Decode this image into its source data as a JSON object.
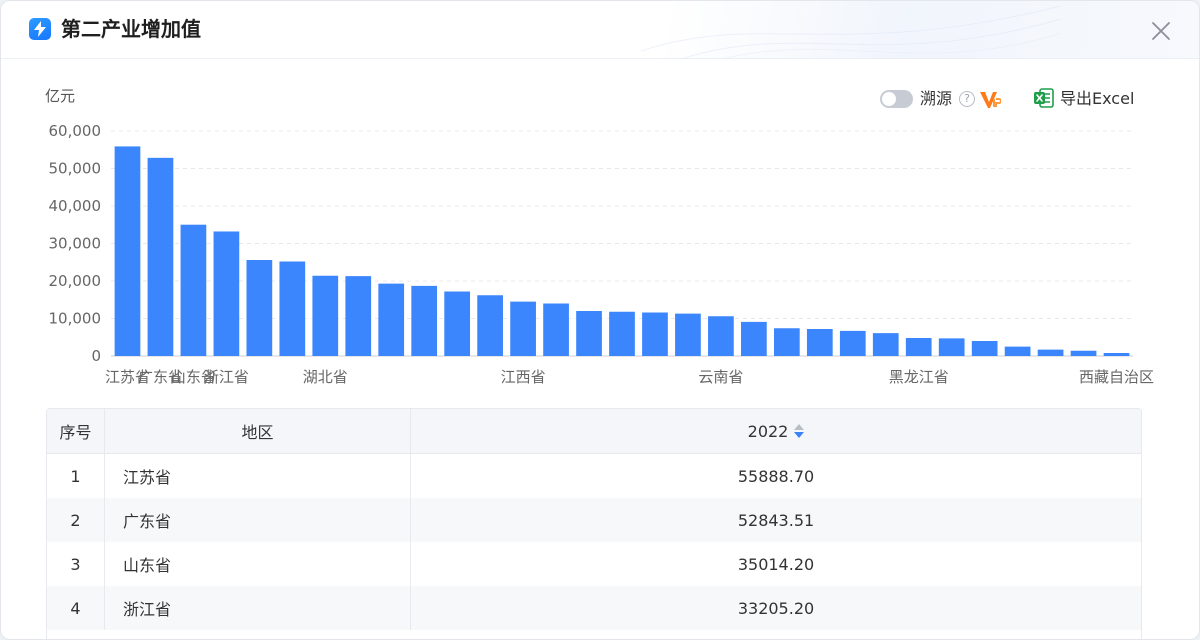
{
  "header": {
    "title": "第二产业增加值"
  },
  "toolbar": {
    "trace_label": "溯源",
    "help_glyph": "?",
    "export_label": "导出Excel"
  },
  "colors": {
    "bar": "#3b86fc",
    "accent": "#1677ff",
    "excel": "#1f9e4a",
    "vip": "#ff7a1a"
  },
  "icons": {
    "logo": "lightning-icon",
    "close": "close-icon",
    "help": "question-icon",
    "vip": "vip-icon",
    "export": "excel-icon"
  },
  "chart_data": {
    "type": "bar",
    "ylabel": "亿元",
    "ylim": [
      0,
      60000
    ],
    "yticks": [
      "0",
      "10,000",
      "20,000",
      "30,000",
      "40,000",
      "50,000",
      "60,000"
    ],
    "grid": true,
    "visible_tick_labels": [
      "江苏省",
      "湖北省",
      "江西省",
      "云南省",
      "黑龙江省",
      "西藏自治区"
    ],
    "categories": [
      "江苏省",
      "广东省",
      "山东省",
      "浙江省",
      "",
      "",
      "湖北省",
      "",
      "",
      "",
      "",
      "",
      "江西省",
      "",
      "",
      "",
      "",
      "",
      "云南省",
      "",
      "",
      "",
      "",
      "",
      "黑龙江省",
      "",
      "",
      "",
      "",
      "",
      "西藏自治区"
    ],
    "values": [
      55888.7,
      52843.51,
      35014.2,
      33205.2,
      25600,
      25200,
      21400,
      21300,
      19300,
      18700,
      17200,
      16200,
      14500,
      14000,
      12000,
      11800,
      11600,
      11300,
      10600,
      9100,
      7400,
      7200,
      6700,
      6100,
      4800,
      4700,
      4000,
      2500,
      1700,
      1400,
      800
    ]
  },
  "table": {
    "headers": {
      "index": "序号",
      "region": "地区",
      "year": "2022"
    },
    "rows": [
      {
        "index": "1",
        "region": "江苏省",
        "value": "55888.70"
      },
      {
        "index": "2",
        "region": "广东省",
        "value": "52843.51"
      },
      {
        "index": "3",
        "region": "山东省",
        "value": "35014.20"
      },
      {
        "index": "4",
        "region": "浙江省",
        "value": "33205.20"
      }
    ]
  }
}
